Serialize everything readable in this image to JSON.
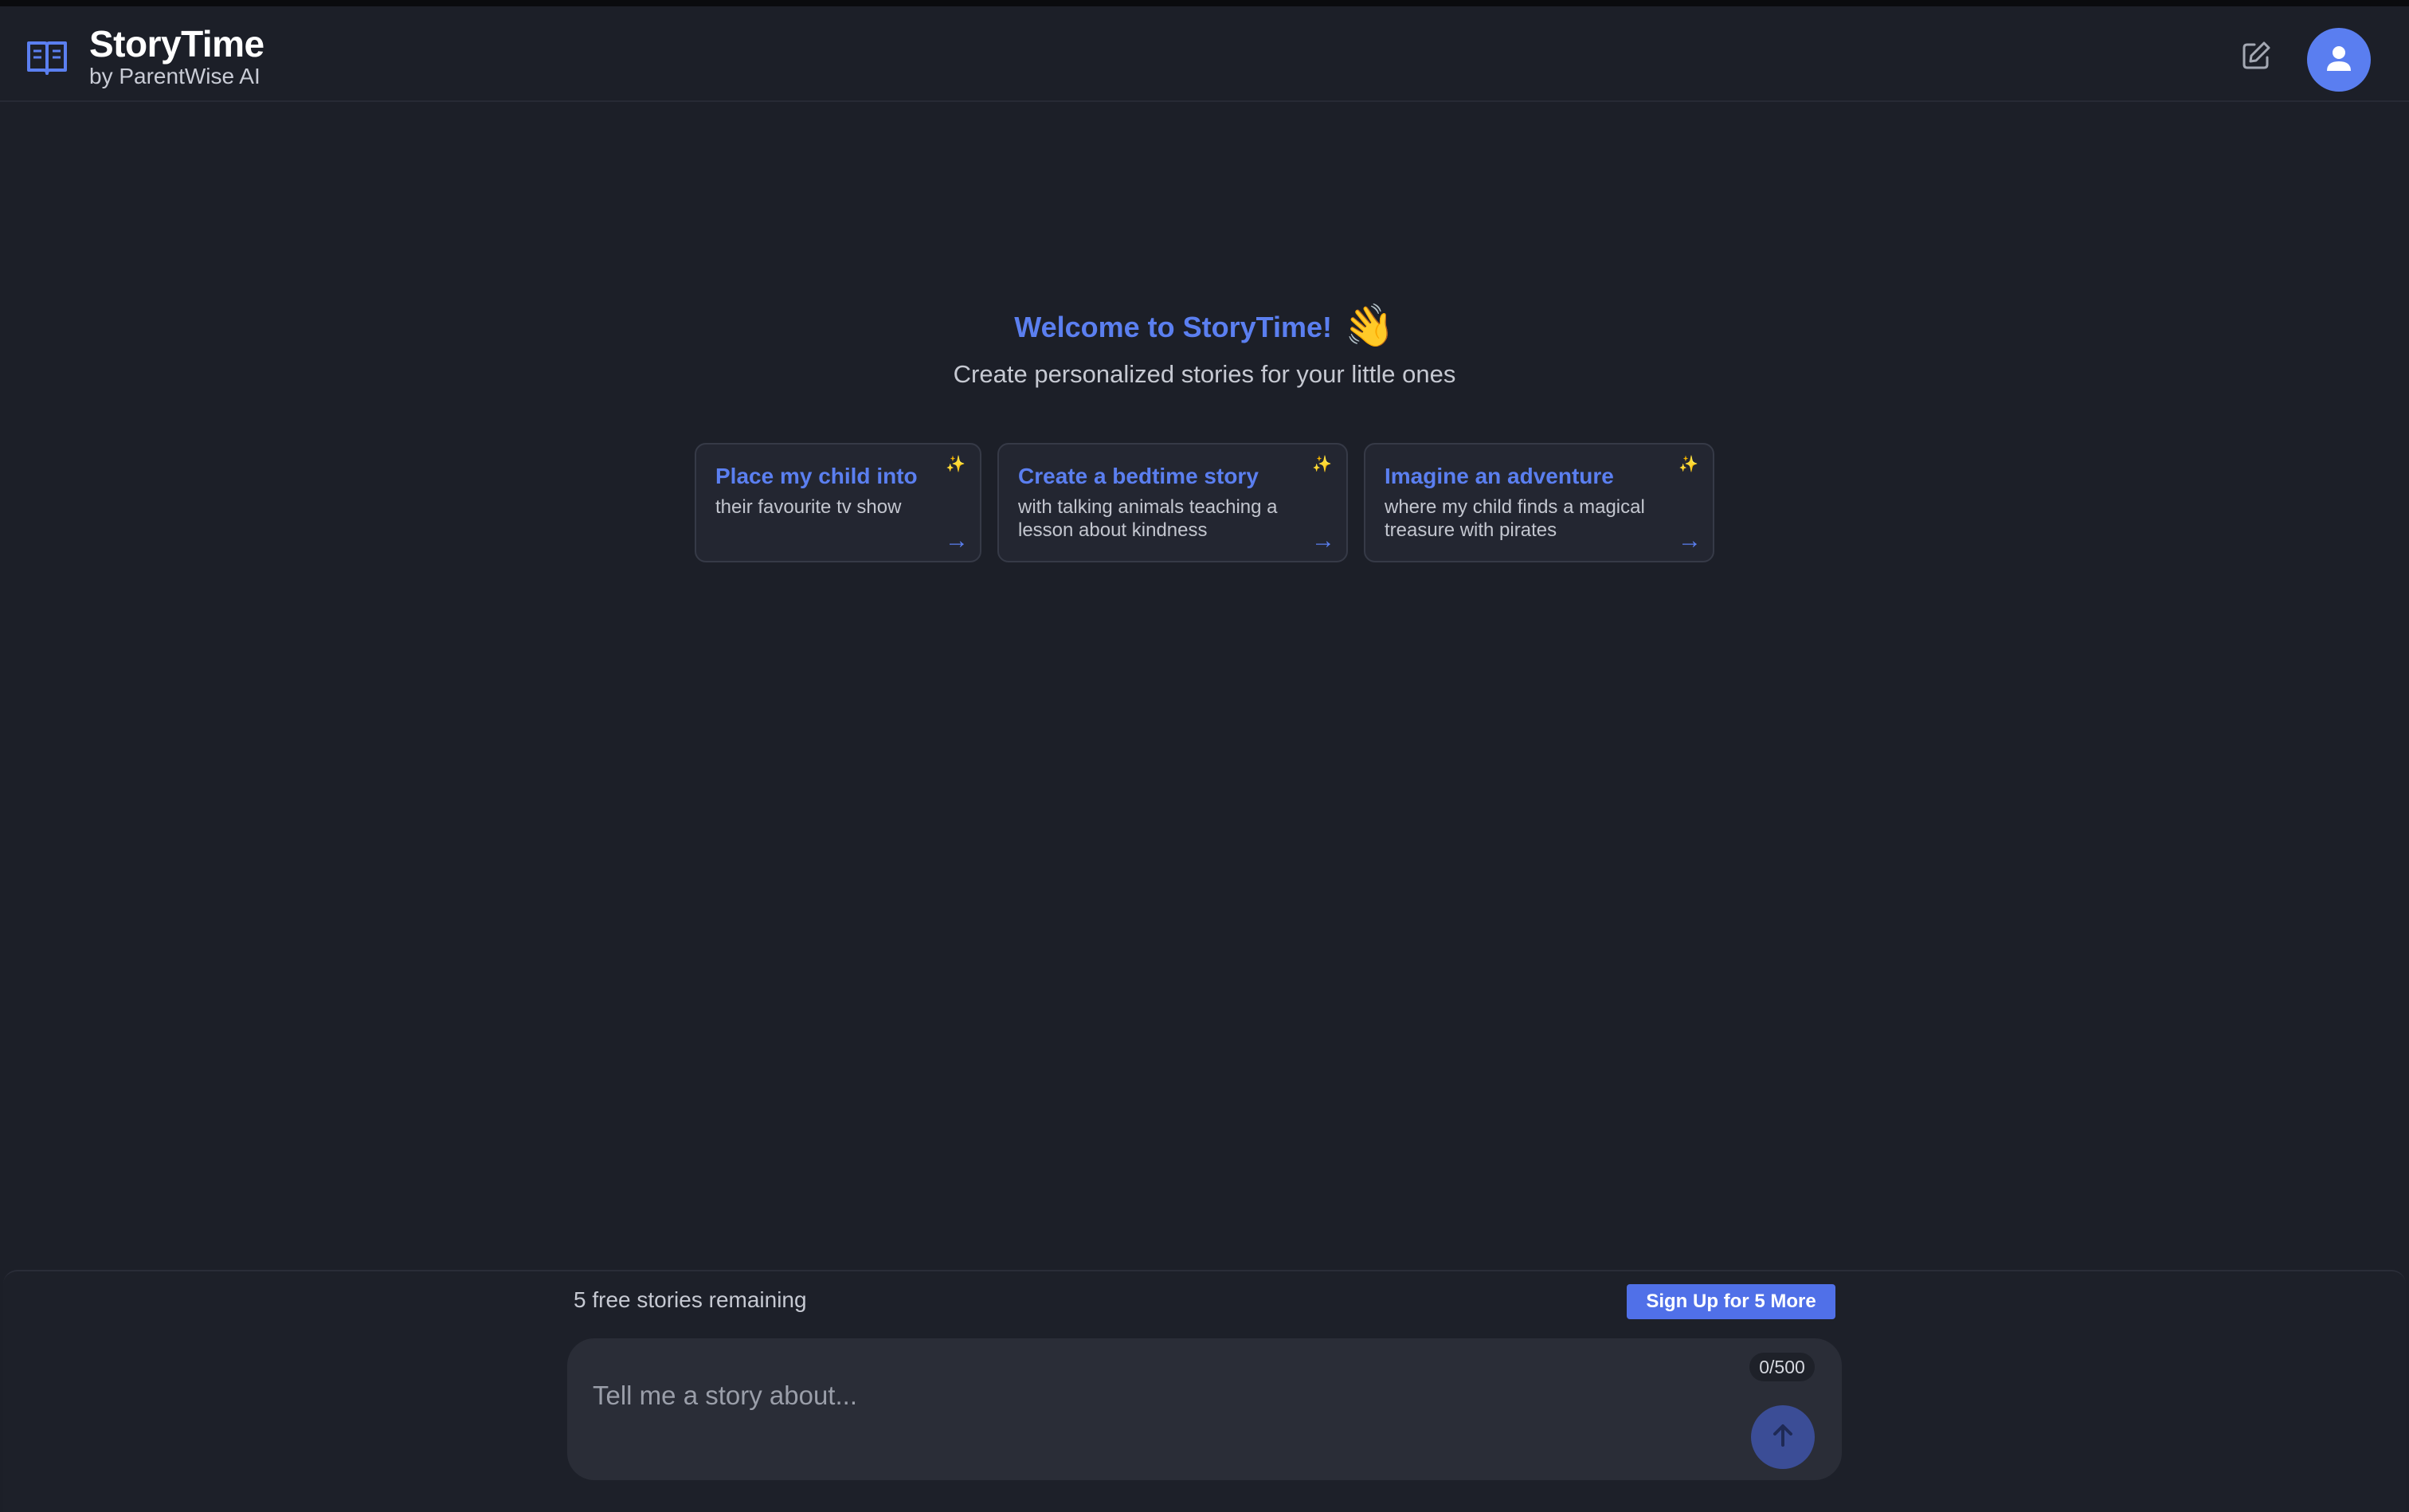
{
  "app": {
    "title": "StoryTime",
    "subtitle": "by ParentWise AI"
  },
  "header": {
    "logo_icon": "open-book-icon",
    "new_story_icon": "edit-icon",
    "avatar_icon": "user-icon"
  },
  "welcome": {
    "title": "Welcome to StoryTime!",
    "emoji": "👋",
    "subtitle": "Create personalized stories for your little ones"
  },
  "suggestions": [
    {
      "title": "Place my child into",
      "description": "their favourite tv show",
      "icon": "sparkle-icon",
      "arrow": "→"
    },
    {
      "title": "Create a bedtime story",
      "description": "with talking animals teaching a lesson about kindness",
      "icon": "sparkle-icon",
      "arrow": "→"
    },
    {
      "title": "Imagine an adventure",
      "description": "where my child finds a magical treasure with pirates",
      "icon": "sparkle-icon",
      "arrow": "→"
    }
  ],
  "composer": {
    "remaining_text": "5 free stories remaining",
    "signup_label": "Sign Up for 5 More",
    "placeholder": "Tell me a story about...",
    "value": "",
    "counter": "0/500",
    "send_icon": "arrow-up-icon"
  },
  "colors": {
    "background": "#1c1f28",
    "accent": "#5b7ff0",
    "card_bg": "#232631",
    "composer_bg": "#2a2d37",
    "signup_bg": "#5070e8",
    "send_bg": "#3b4d96",
    "avatar_bg": "#5a7ef0"
  }
}
